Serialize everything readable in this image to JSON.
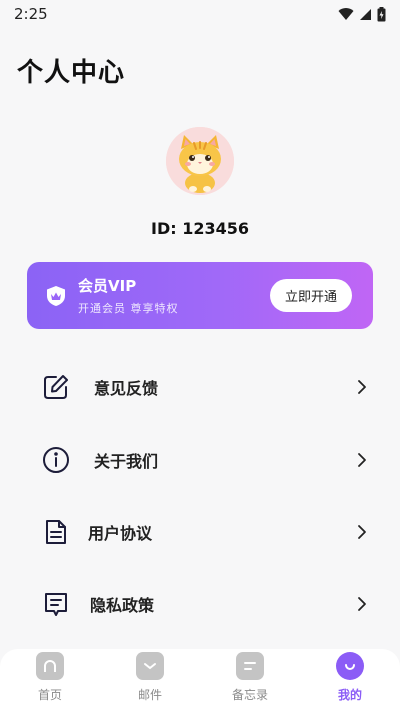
{
  "status": {
    "time": "2:25"
  },
  "header": {
    "title": "个人中心"
  },
  "profile": {
    "id_text": "ID: 123456"
  },
  "vip": {
    "title": "会员VIP",
    "subtitle": "开通会员  尊享特权",
    "button": "立即开通"
  },
  "menu": [
    {
      "label": "意见反馈",
      "icon": "edit-icon"
    },
    {
      "label": "关于我们",
      "icon": "info-icon"
    },
    {
      "label": "用户协议",
      "icon": "document-icon"
    },
    {
      "label": "隐私政策",
      "icon": "policy-icon"
    }
  ],
  "tabs": [
    {
      "label": "首页",
      "icon": "home-icon",
      "active": false
    },
    {
      "label": "邮件",
      "icon": "mail-icon",
      "active": false
    },
    {
      "label": "备忘录",
      "icon": "memo-icon",
      "active": false
    },
    {
      "label": "我的",
      "icon": "profile-icon",
      "active": true
    }
  ],
  "colors": {
    "accent": "#8b5cf6",
    "vip_start": "#8b63f5",
    "vip_end": "#c066f5",
    "tab_inactive": "#c4c4c4"
  }
}
